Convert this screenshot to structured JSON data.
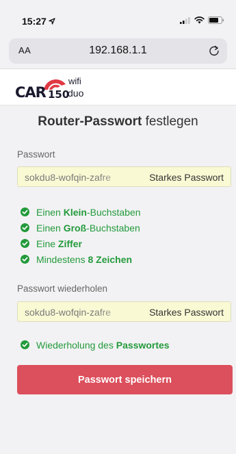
{
  "status_bar": {
    "time": "15:27"
  },
  "browser": {
    "text_size_label": "AA",
    "url": "192.168.1.1"
  },
  "logo": {
    "brand": "CAR",
    "model": "150",
    "wifi": "wifi",
    "variant": "duo"
  },
  "page": {
    "title_bold": "Router-Passwort",
    "title_rest": "festlegen"
  },
  "password": {
    "label": "Passwort",
    "value": "sokdu8-wofqin-zafre",
    "strength": "Starkes Passwort"
  },
  "requirements": [
    {
      "pre": "Einen ",
      "bold": "Klein",
      "post": "-Buchstaben"
    },
    {
      "pre": "Einen ",
      "bold": "Groß",
      "post": "-Buchstaben"
    },
    {
      "pre": "Eine ",
      "bold": "Ziffer",
      "post": ""
    },
    {
      "pre": "Mindestens ",
      "bold": "8 Zeichen",
      "post": ""
    }
  ],
  "confirm": {
    "label": "Passwort wiederholen",
    "value": "sokdu8-wofqin-zafre",
    "strength": "Starkes Passwort",
    "check": {
      "pre": "Wiederholung des ",
      "bold": "Passwortes",
      "post": ""
    }
  },
  "save_button": "Passwort speichern",
  "colors": {
    "accent": "#dc4f5c",
    "success": "#239a3b",
    "field_bg": "#f9f9d4"
  }
}
